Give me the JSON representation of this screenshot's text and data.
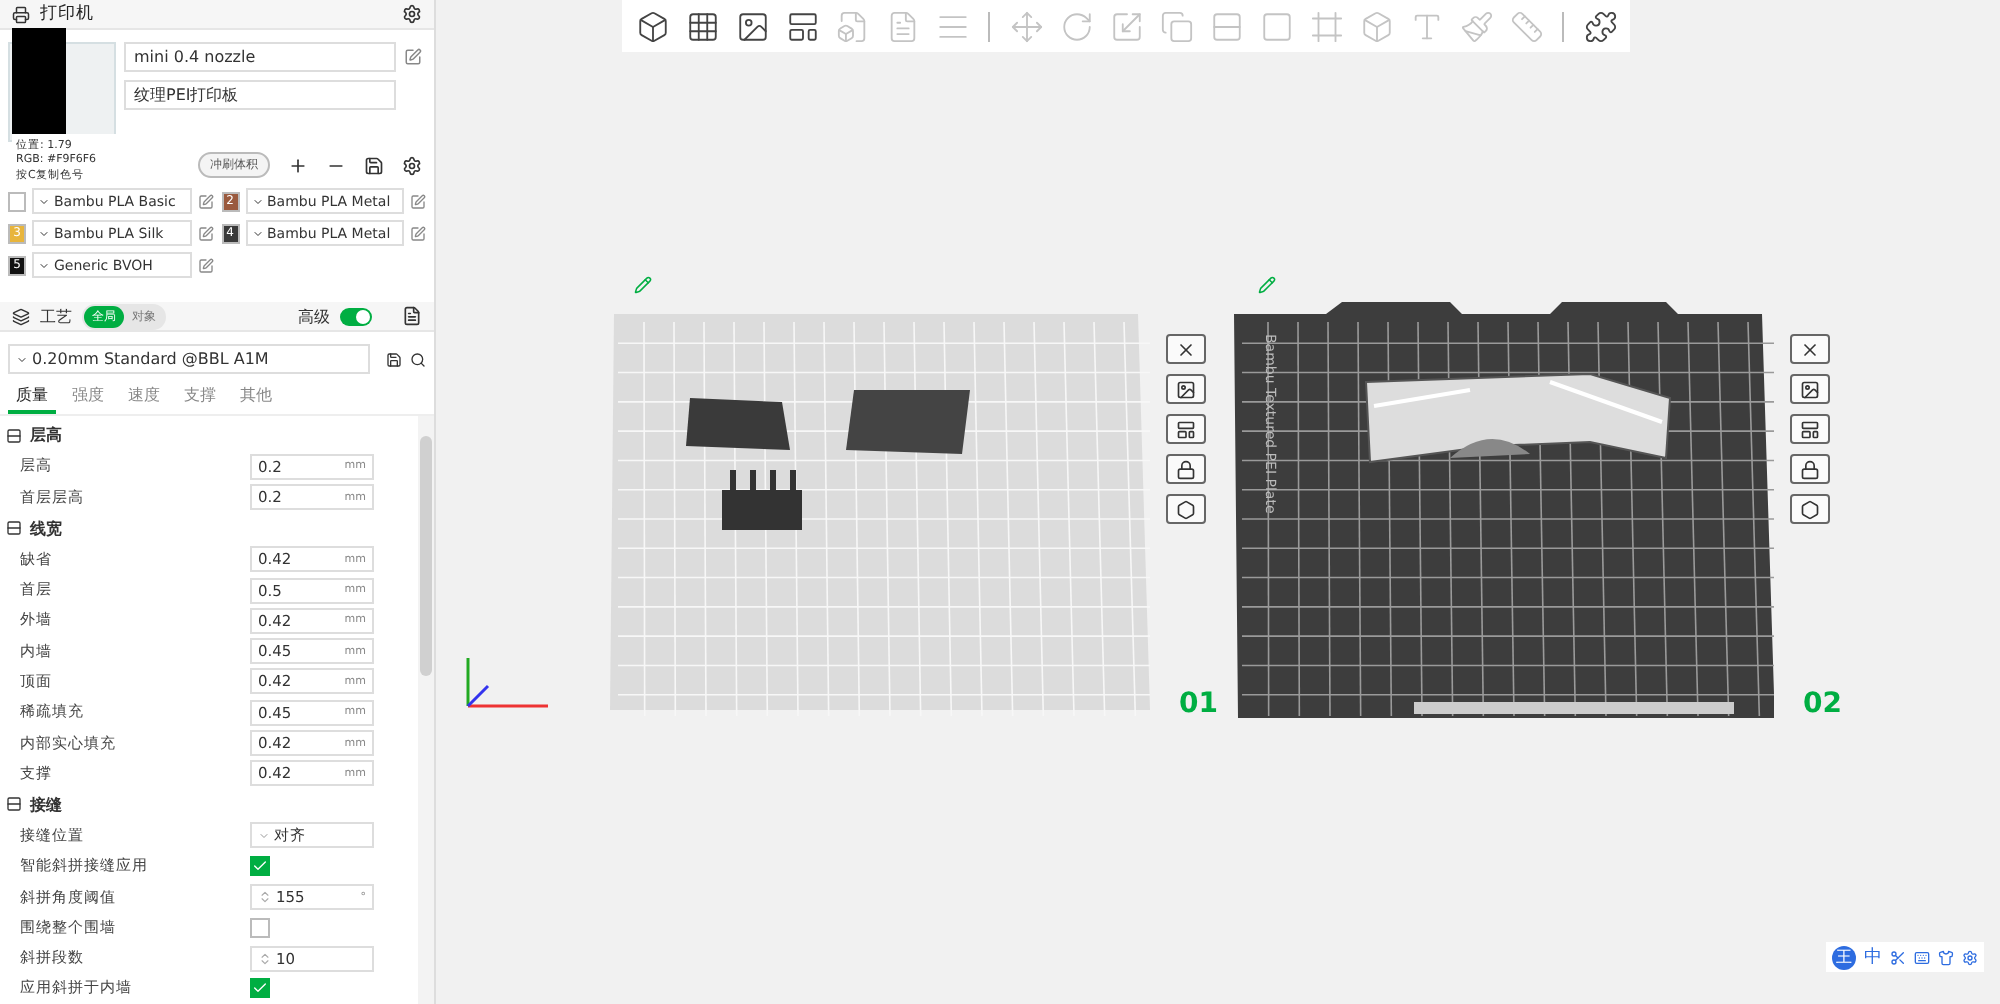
{
  "printer": {
    "title": "打印机",
    "nozzle": "mini 0.4 nozzle",
    "plate": "纹理PEI打印板",
    "flush_button": "冲刷体积"
  },
  "color_picker": {
    "position": "位置: 1.79",
    "rgb": "RGB: #F9F6F6",
    "hint": "按C复制色号"
  },
  "filaments": [
    {
      "name": "Bambu PLA Basic",
      "color": "#ffffff"
    },
    {
      "number": "2",
      "name": "Bambu PLA Metal",
      "color": "#9a5a3e"
    },
    {
      "number": "3",
      "name": "Bambu PLA Silk",
      "color": "#e8b53c"
    },
    {
      "number": "4",
      "name": "Bambu PLA Metal",
      "color": "#3a3a3a"
    },
    {
      "number": "5",
      "name": "Generic BVOH",
      "color": "#111111"
    }
  ],
  "process": {
    "title": "工艺",
    "scope": [
      {
        "label": "全局",
        "selected": true
      },
      {
        "label": "对象",
        "selected": false
      }
    ],
    "advanced_label": "高级",
    "advanced": true,
    "preset": "0.20mm Standard @BBL A1M",
    "tabs": [
      {
        "label": "质量",
        "selected": true
      },
      {
        "label": "强度",
        "selected": false
      },
      {
        "label": "速度",
        "selected": false
      },
      {
        "label": "支撑",
        "selected": false
      },
      {
        "label": "其他",
        "selected": false
      }
    ],
    "groups": [
      {
        "title": "层高",
        "rows": [
          {
            "kind": "input",
            "label": "层高",
            "value": "0.2",
            "unit": "mm"
          },
          {
            "kind": "input",
            "label": "首层层高",
            "value": "0.2",
            "unit": "mm"
          }
        ]
      },
      {
        "title": "线宽",
        "rows": [
          {
            "kind": "input",
            "label": "缺省",
            "value": "0.42",
            "unit": "mm"
          },
          {
            "kind": "input",
            "label": "首层",
            "value": "0.5",
            "unit": "mm"
          },
          {
            "kind": "input",
            "label": "外墙",
            "value": "0.42",
            "unit": "mm"
          },
          {
            "kind": "input",
            "label": "内墙",
            "value": "0.45",
            "unit": "mm"
          },
          {
            "kind": "input",
            "label": "顶面",
            "value": "0.42",
            "unit": "mm"
          },
          {
            "kind": "input",
            "label": "稀疏填充",
            "value": "0.45",
            "unit": "mm"
          },
          {
            "kind": "input",
            "label": "内部实心填充",
            "value": "0.42",
            "unit": "mm"
          },
          {
            "kind": "input",
            "label": "支撑",
            "value": "0.42",
            "unit": "mm"
          }
        ]
      },
      {
        "title": "接缝",
        "rows": [
          {
            "kind": "select",
            "label": "接缝位置",
            "value": "对齐"
          },
          {
            "kind": "checkbox",
            "label": "智能斜拼接缝应用",
            "checked": true
          },
          {
            "kind": "spin",
            "label": "斜拼角度阈值",
            "value": "155",
            "unit": "°"
          },
          {
            "kind": "checkbox",
            "label": "围绕整个围墙",
            "checked": false
          },
          {
            "kind": "spin",
            "label": "斜拼段数",
            "value": "10"
          },
          {
            "kind": "checkbox",
            "label": "应用斜拼于内墙",
            "checked": true
          }
        ]
      }
    ]
  },
  "toolbar": [
    {
      "disabled": false
    },
    {
      "disabled": false
    },
    {
      "disabled": false
    },
    {
      "disabled": false
    },
    {
      "disabled": true
    },
    {
      "disabled": true
    },
    {
      "disabled": true
    },
    {
      "kind": "separator"
    },
    {
      "disabled": true
    },
    {
      "disabled": true
    },
    {
      "disabled": true
    },
    {
      "disabled": true
    },
    {
      "disabled": true
    },
    {
      "disabled": true
    },
    {
      "disabled": true
    },
    {
      "disabled": true
    },
    {
      "disabled": true
    },
    {
      "disabled": true
    },
    {
      "disabled": true
    },
    {
      "kind": "separator"
    },
    {
      "disabled": false
    }
  ],
  "plates": [
    {
      "label": "01",
      "kind": "smooth"
    },
    {
      "label": "02",
      "kind": "textured",
      "plate_name": "Bambu Textured PEI Plate"
    }
  ],
  "ime": {
    "logo": "王",
    "mode": "中"
  }
}
